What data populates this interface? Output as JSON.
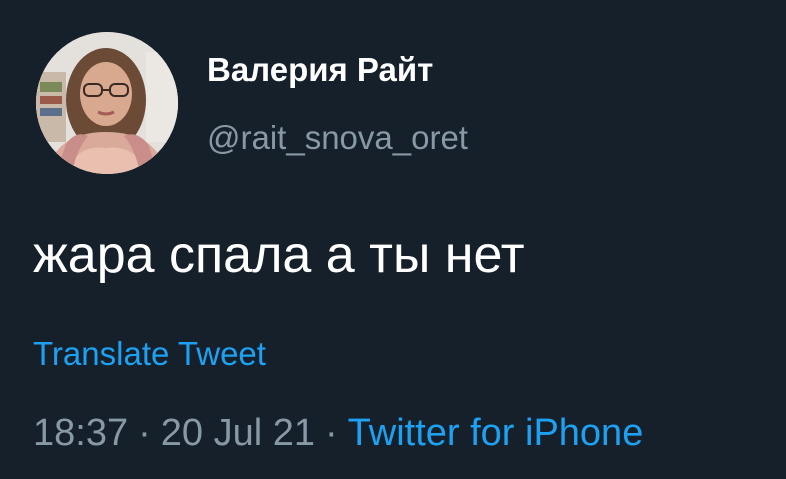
{
  "author": {
    "display_name": "Валерия Райт",
    "handle": "@rait_snova_oret",
    "avatar_icon": "user-avatar-photo"
  },
  "tweet": {
    "text": "жара спала а ты нет",
    "translate_label": "Translate Tweet",
    "time": "18:37",
    "date": "20 Jul 21",
    "separator": "·",
    "source": "Twitter for iPhone"
  },
  "colors": {
    "background": "#15202b",
    "primary_text": "#ffffff",
    "secondary_text": "#8899a6",
    "accent": "#1da1f2"
  }
}
